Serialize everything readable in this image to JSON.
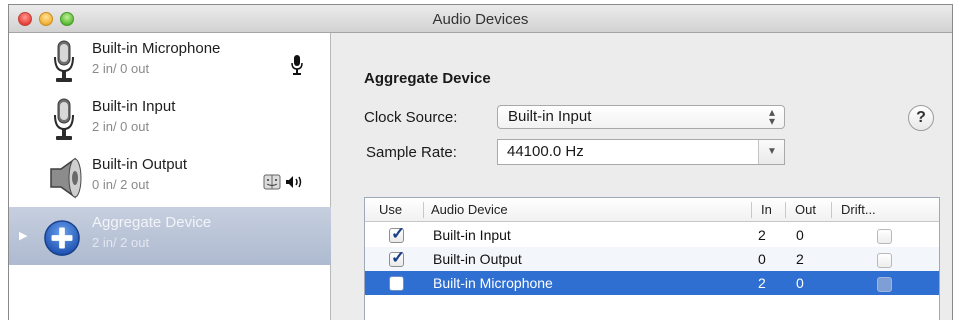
{
  "window": {
    "title": "Audio Devices"
  },
  "sidebar": {
    "devices": [
      {
        "name": "Built-in Microphone",
        "io": "2 in/ 0 out",
        "icon": "microphone-icon",
        "badge": "microphone-badge-icon"
      },
      {
        "name": "Built-in Input",
        "io": "2 in/ 0 out",
        "icon": "microphone-icon"
      },
      {
        "name": "Built-in Output",
        "io": "0 in/ 2 out",
        "icon": "speaker-icon",
        "badge": "finder-and-speaker-badge-icon"
      },
      {
        "name": "Aggregate Device",
        "io": "2 in/ 2 out",
        "icon": "aggregate-plus-icon",
        "selected": true
      }
    ]
  },
  "detail": {
    "title": "Aggregate Device",
    "clock_source_label": "Clock Source:",
    "clock_source_value": "Built-in Input",
    "sample_rate_label": "Sample Rate:",
    "sample_rate_value": "44100.0 Hz",
    "help_label": "?"
  },
  "table": {
    "columns": [
      "Use",
      "Audio Device",
      "In",
      "Out",
      "Drift..."
    ],
    "rows": [
      {
        "use": true,
        "device": "Built-in Input",
        "in": "2",
        "out": "0",
        "drift": false
      },
      {
        "use": true,
        "device": "Built-in Output",
        "in": "0",
        "out": "2",
        "drift": false
      },
      {
        "use": false,
        "device": "Built-in Microphone",
        "in": "2",
        "out": "0",
        "drift": false,
        "selected": true
      }
    ]
  },
  "colors": {
    "selection": "#2f6fd1",
    "sidebar_selection": "#b4bfd4"
  }
}
